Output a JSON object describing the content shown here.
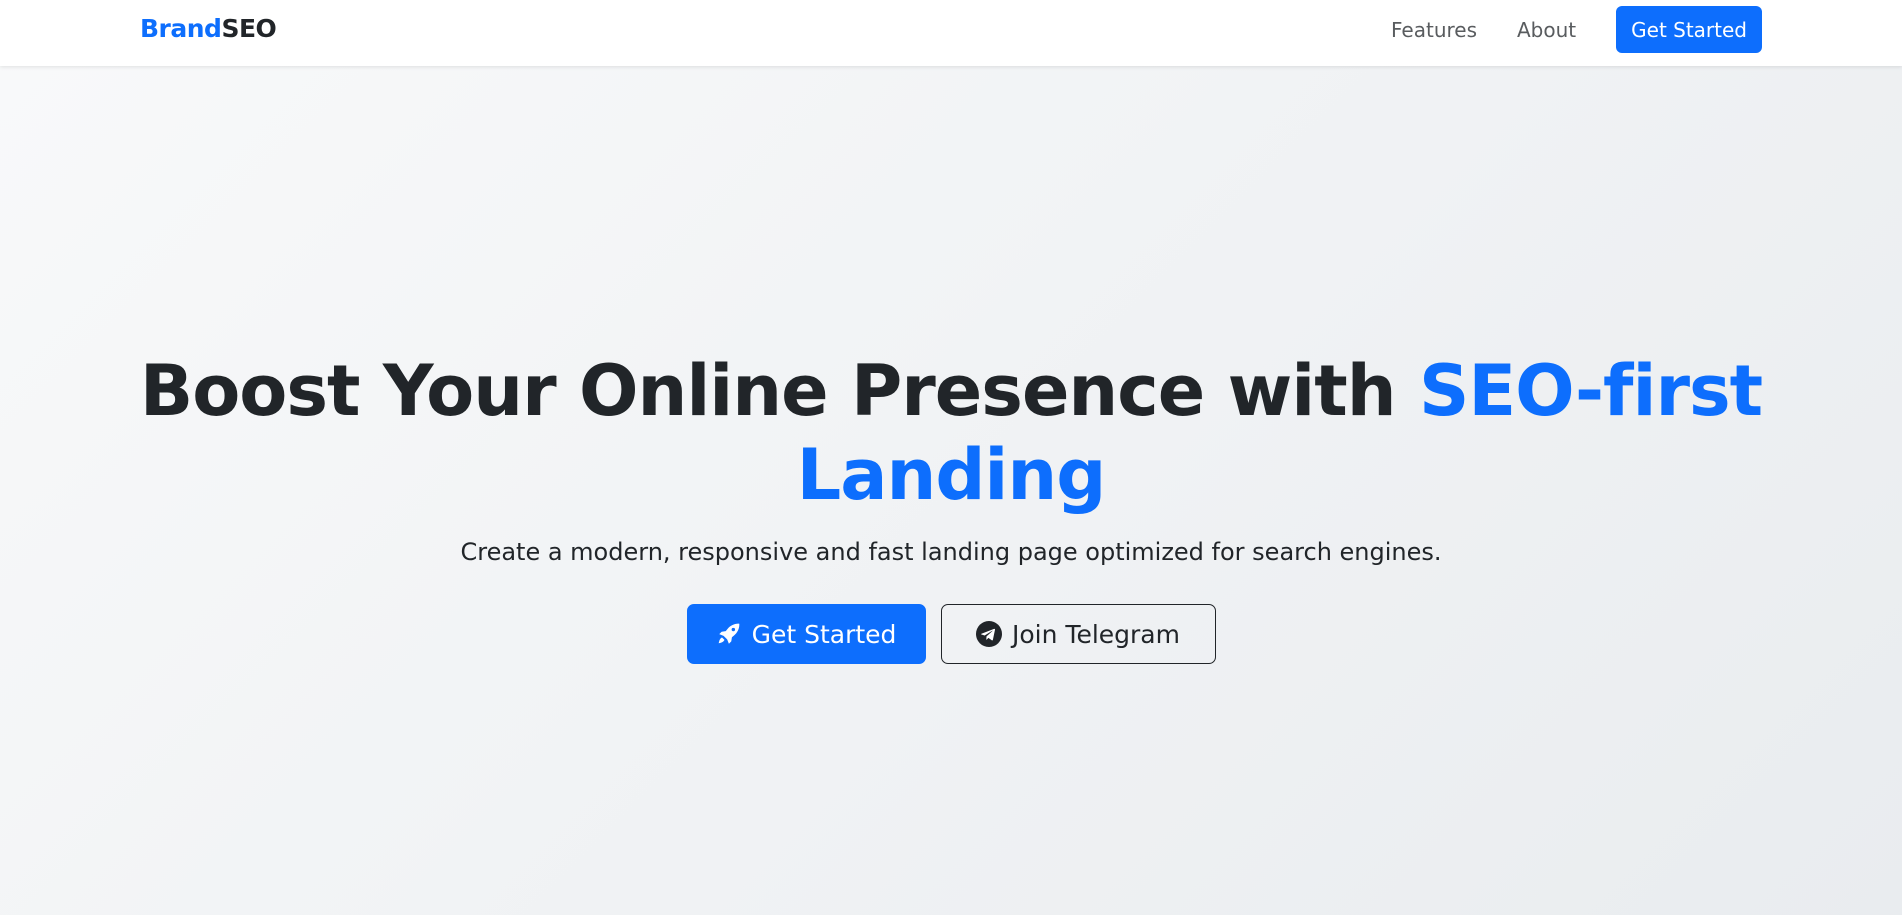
{
  "navbar": {
    "brand_part1": "Brand",
    "brand_part2": "SEO",
    "links": [
      {
        "label": "Features"
      },
      {
        "label": "About"
      }
    ],
    "cta_label": "Get Started"
  },
  "hero": {
    "title_main": "Boost Your Online Presence with ",
    "title_highlight": "SEO-first Landing",
    "subtitle": "Create a modern, responsive and fast landing page optimized for search engines.",
    "primary_button": {
      "label": "Get Started",
      "icon": "rocket-icon"
    },
    "secondary_button": {
      "label": "Join Telegram",
      "icon": "telegram-icon"
    }
  },
  "colors": {
    "accent": "#0d6efd",
    "text": "#212529",
    "muted_link": "#595c5f",
    "hero_gradient_start": "#f8f9fa",
    "hero_gradient_end": "#e9ecef"
  }
}
